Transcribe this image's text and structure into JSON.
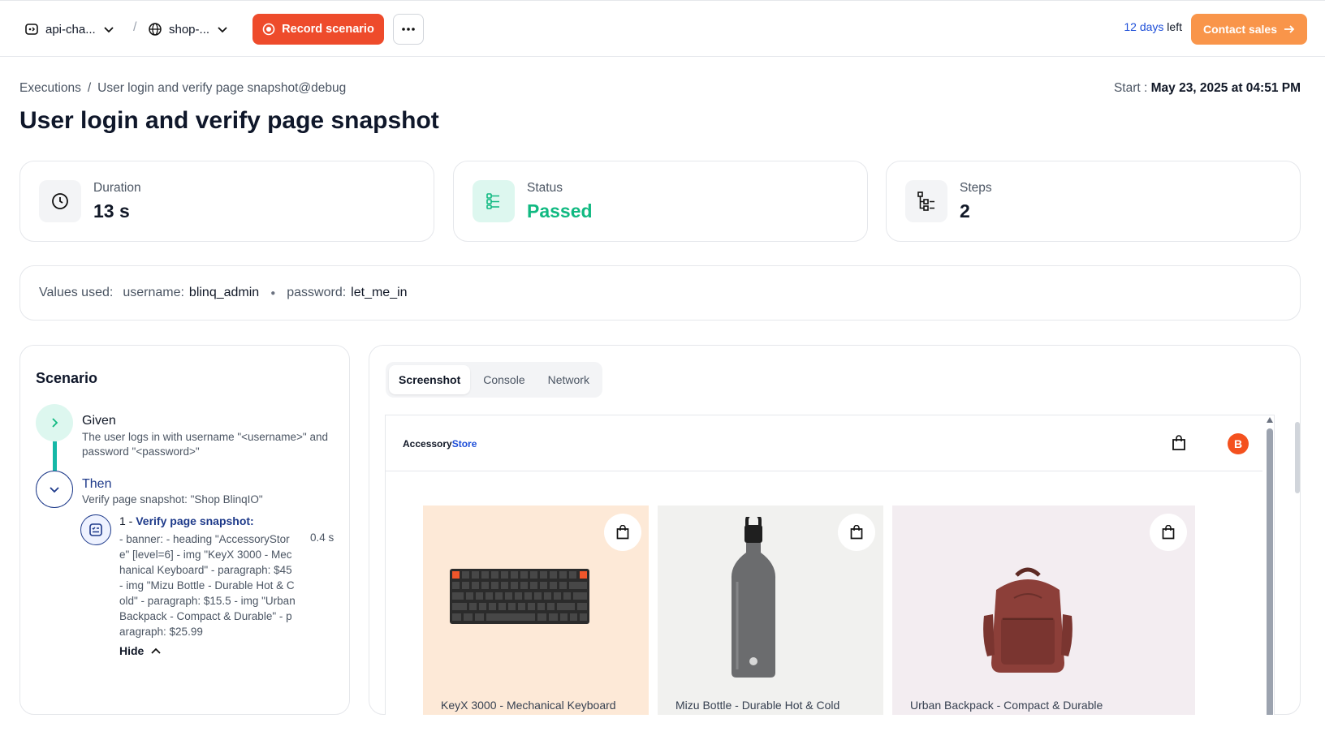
{
  "topbar": {
    "project": "api-cha...",
    "environment": "shop-...",
    "record_label": "Record scenario",
    "trial_days": "12 days",
    "trial_suffix": " left",
    "contact_label": "Contact sales"
  },
  "breadcrumb": {
    "root": "Executions",
    "separator": "/",
    "current": "User login and verify page snapshot@debug"
  },
  "start": {
    "label": "Start :",
    "value": "May 23, 2025 at 04:51 PM"
  },
  "title": "User login and verify page snapshot",
  "stats": {
    "duration": {
      "label": "Duration",
      "value": "13 s"
    },
    "status": {
      "label": "Status",
      "value": "Passed",
      "color": "#10b981"
    },
    "steps": {
      "label": "Steps",
      "value": "2"
    }
  },
  "values_used": {
    "label": "Values used:",
    "items": [
      {
        "key": "username:",
        "value": "blinq_admin"
      },
      {
        "key": "password:",
        "value": "let_me_in"
      }
    ]
  },
  "scenario": {
    "heading": "Scenario",
    "given": {
      "keyword": "Given",
      "text": "The user logs in with username \"<username>\" and password \"<password>\""
    },
    "then": {
      "keyword": "Then",
      "text": "Verify page snapshot: \"Shop BlinqIO\"",
      "substep": {
        "index": "1 -",
        "title": "Verify page snapshot:",
        "body": "- banner: - heading \"AccessoryStore\" [level=6] - img \"KeyX 3000 - Mechanical Keyboard\" - paragraph: $45 - img \"Mizu Bottle - Durable Hot & Cold\" - paragraph: $15.5 - img \"Urban Backpack - Compact & Durable\" - paragraph: $25.99",
        "time": "0.4 s",
        "hide_label": "Hide"
      }
    }
  },
  "tabs": [
    "Screenshot",
    "Console",
    "Network"
  ],
  "active_tab": "Screenshot",
  "snapshot": {
    "store_name": "Accessory",
    "store_accent": "Store",
    "avatar_letter": "B",
    "products": [
      {
        "name": "KeyX 3000 - Mechanical Keyboard",
        "bg": "#fde9d7"
      },
      {
        "name": "Mizu Bottle - Durable Hot & Cold",
        "bg": "#f1f1ef"
      },
      {
        "name": "Urban Backpack - Compact & Durable",
        "bg": "#f3edf1"
      }
    ]
  },
  "colors": {
    "record": "#ee4b2b",
    "contact": "#f9954a",
    "passed": "#10b981",
    "link": "#1e3a8a"
  }
}
